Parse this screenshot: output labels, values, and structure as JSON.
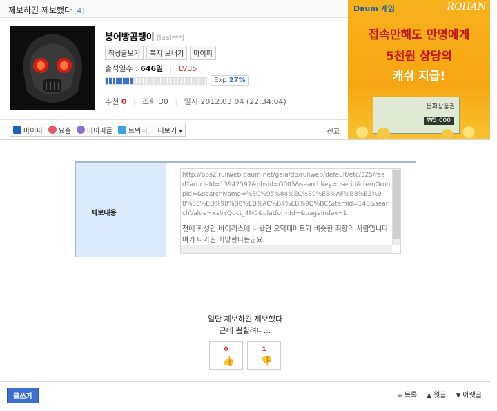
{
  "post": {
    "title": "제보하긴 제보했다",
    "comment_count": "[4]"
  },
  "author": {
    "nickname": "붕어빵곰탱이",
    "id": "(leel***)",
    "buttons": [
      "작성글보기",
      "쪽지 보내기",
      "마이피"
    ],
    "attendance_label": "출석일수 :",
    "attendance_value": "646일",
    "level": "LV35",
    "exp_label": "Exp.",
    "exp_value": "27%",
    "exp_fraction": 0.27
  },
  "meta": {
    "recommend_label": "추천",
    "recommend_value": "0",
    "views_label": "조회",
    "views_value": "30",
    "date_label": "일시",
    "date_value": "2012.03.04 (22:34:04)"
  },
  "share": {
    "items": [
      {
        "label": "마이피",
        "icon": "cube-icon",
        "color": "#1f5fbf"
      },
      {
        "label": "요즘",
        "icon": "face-icon",
        "color": "#e45a6a"
      },
      {
        "label": "마이피플",
        "icon": "people-icon",
        "color": "#8a6fd1"
      },
      {
        "label": "트위터",
        "icon": "twitter-icon",
        "color": "#36a5e0"
      }
    ],
    "more_label": "더보기",
    "report_label": "신고"
  },
  "ad": {
    "brand_left": "Daum 게임",
    "brand_right": "ROHAN",
    "line1": "접속만해도 만명에게",
    "line2": "5천원 상당의",
    "line3": "캐쉬 지급!",
    "card_title": "문화상품권",
    "card_value": "₩5,000"
  },
  "report_box": {
    "label": "제보내용",
    "url": "http://bbs2.ruliweb.daum.net/gaia/do/ruliweb/default/etc/325/read?articleId=13942597&bbsId=G005&searchKey=userid&itemGroupId=&searchName=%EC%95%84%EC%80%EB%AF%B8%E2%98%85%ED%98%B8%EB%AC%B4%EB%9D%BC&itemId=143&searchValue=XsbYQuct_4M0&platformId=&pageIndex=1",
    "text": "전에 화성인 바이러스에 나왔던 오덕페이트와 비슷한 취향의 사람입니다 여기 나가길 희망한다는군요"
  },
  "body": {
    "line1": "일단 제보하긴 제보했다",
    "line2": "근데 뽑힐려나..."
  },
  "votes": {
    "up": "0",
    "down": "1"
  },
  "footer": {
    "write_label": "글쓰기",
    "list_label": "목록",
    "prev_label": "윗글",
    "next_label": "아랫글"
  }
}
